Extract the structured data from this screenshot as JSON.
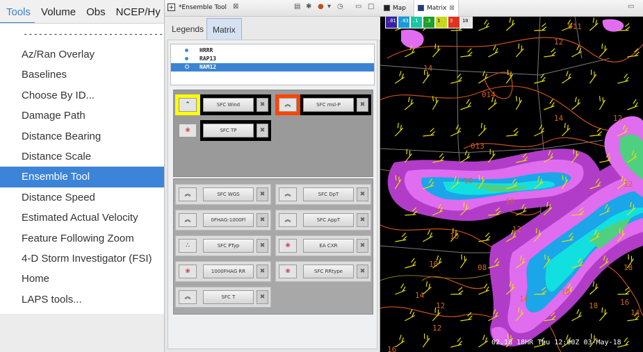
{
  "menubar": {
    "items": [
      "Tools",
      "Volume",
      "Obs",
      "NCEP/Hy"
    ],
    "active_index": 0
  },
  "tools_menu": {
    "separator": "--------------------------------",
    "items": [
      "Az/Ran Overlay",
      "Baselines",
      "Choose By ID...",
      "Damage Path",
      "Distance Bearing",
      "Distance Scale",
      "Ensemble Tool",
      "Distance Speed",
      "Estimated Actual Velocity",
      "Feature Following Zoom",
      "4-D Storm Investigator (FSI)",
      "Home",
      "LAPS tools..."
    ],
    "selected": "Ensemble Tool"
  },
  "ensemble_tool": {
    "title": "*Ensemble Tool",
    "tabs": [
      "Legends",
      "Matrix"
    ],
    "active_tab": "Matrix",
    "models": [
      "HRRR",
      "RAP13",
      "NAM12"
    ],
    "selected_model": "NAM12",
    "top_fields": [
      {
        "label": "SFC Wind",
        "icon": "chevron-up-icon",
        "frame_color": "#ffff00"
      },
      {
        "label": "SFC msl-P",
        "icon": "double-chevron-up-icon",
        "frame_color": "#ff4500"
      },
      {
        "label": "SFC TP",
        "icon": "color-blobs-icon",
        "frame_color": "#000000"
      }
    ],
    "bottom_fields": [
      {
        "label": "SFC WGS",
        "icon": "double-chevron-up-icon"
      },
      {
        "label": "SFC DpT",
        "icon": "double-chevron-up-icon"
      },
      {
        "label": "0FHAG-1000Fl",
        "icon": "double-chevron-up-icon"
      },
      {
        "label": "SFC AppT",
        "icon": "double-chevron-up-icon"
      },
      {
        "label": "SFC PTyp",
        "icon": "dots-icon"
      },
      {
        "label": "EA CXR",
        "icon": "color-blobs-icon"
      },
      {
        "label": "1000FHAG RR",
        "icon": "color-blobs-icon"
      },
      {
        "label": "SFC RRtype",
        "icon": "color-blobs-icon"
      },
      {
        "label": "SFC T",
        "icon": "double-chevron-up-icon"
      }
    ],
    "close_glyph": "✖"
  },
  "map_view": {
    "tabs": [
      "Map",
      "Matrix"
    ],
    "active_tab": "Matrix",
    "colorbar": [
      {
        "label": ".01",
        "color": "#3a22a6"
      },
      {
        "label": ".03",
        "color": "#1a9ad6"
      },
      {
        "label": ".1",
        "color": "#19c7a8"
      },
      {
        "label": ".3",
        "color": "#1ea02a"
      },
      {
        "label": "1",
        "color": "#c9d61e"
      },
      {
        "label": "3",
        "color": "#e03320"
      },
      {
        "label": "10",
        "color": "#e6e6e6"
      }
    ],
    "pressure_labels": [
      "011",
      "014",
      "013"
    ],
    "temp_labels": [
      "12",
      "14",
      "12",
      "14",
      "12",
      "10",
      "10",
      "10",
      "12",
      "10",
      "08",
      "10",
      "14",
      "12",
      "14",
      "16",
      "18",
      "12",
      "16",
      "18",
      "14"
    ],
    "status": "02.18  18HR Thu 12:00Z 03-May-18"
  }
}
